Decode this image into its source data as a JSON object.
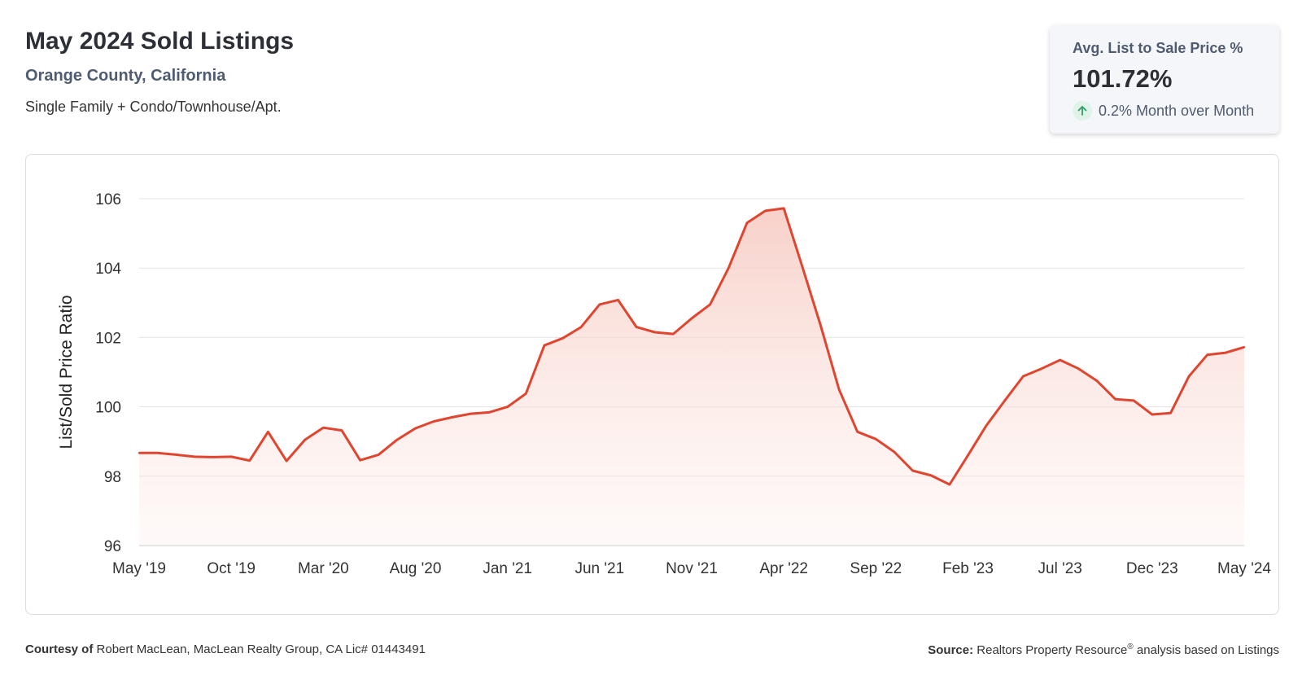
{
  "header": {
    "title": "May 2024 Sold Listings",
    "location": "Orange County, California",
    "segment": "Single Family + Condo/Townhouse/Apt."
  },
  "kpi": {
    "label": "Avg. List to Sale Price %",
    "value": "101.72%",
    "change": "0.2% Month over Month",
    "change_icon": "arrow-up-icon",
    "change_color": "#2e9e6a"
  },
  "footer": {
    "courtesy_label": "Courtesy of",
    "courtesy_text": "Robert MacLean, MacLean Realty Group, CA Lic# 01443491",
    "source_label": "Source:",
    "source_text_1": "Realtors Property Resource",
    "source_sup": "®",
    "source_text_2": "analysis based on Listings"
  },
  "colors": {
    "line": "#e0452f",
    "fill_top": "#f6c9c0",
    "grid": "#e3e3e3",
    "axis_text": "#333333"
  },
  "chart_data": {
    "type": "area",
    "title": "",
    "xlabel": "",
    "ylabel": "List/Sold Price Ratio",
    "ylim": [
      96,
      106
    ],
    "yticks": [
      96,
      98,
      100,
      102,
      104,
      106
    ],
    "grid": true,
    "x_tick_labels": [
      "May '19",
      "Oct '19",
      "Mar '20",
      "Aug '20",
      "Jan '21",
      "Jun '21",
      "Nov '21",
      "Apr '22",
      "Sep '22",
      "Feb '23",
      "Jul '23",
      "Dec '23",
      "May '24"
    ],
    "x": [
      "May '19",
      "Jun '19",
      "Jul '19",
      "Aug '19",
      "Sep '19",
      "Oct '19",
      "Nov '19",
      "Dec '19",
      "Jan '20",
      "Feb '20",
      "Mar '20",
      "Apr '20",
      "May '20",
      "Jun '20",
      "Jul '20",
      "Aug '20",
      "Sep '20",
      "Oct '20",
      "Nov '20",
      "Dec '20",
      "Jan '21",
      "Feb '21",
      "Mar '21",
      "Apr '21",
      "May '21",
      "Jun '21",
      "Jul '21",
      "Aug '21",
      "Sep '21",
      "Oct '21",
      "Nov '21",
      "Dec '21",
      "Jan '22",
      "Feb '22",
      "Mar '22",
      "Apr '22",
      "May '22",
      "Jun '22",
      "Jul '22",
      "Aug '22",
      "Sep '22",
      "Oct '22",
      "Nov '22",
      "Dec '22",
      "Jan '23",
      "Feb '23",
      "Mar '23",
      "Apr '23",
      "May '23",
      "Jun '23",
      "Jul '23",
      "Aug '23",
      "Sep '23",
      "Oct '23",
      "Nov '23",
      "Dec '23",
      "Jan '24",
      "Feb '24",
      "Mar '24",
      "Apr '24",
      "May '24"
    ],
    "series": [
      {
        "values": [
          98.67,
          98.67,
          98.62,
          98.56,
          98.55,
          98.56,
          98.45,
          99.28,
          98.44,
          99.05,
          99.4,
          99.32,
          98.46,
          98.62,
          99.05,
          99.38,
          99.58,
          99.7,
          99.8,
          99.84,
          100.0,
          100.38,
          101.77,
          101.98,
          102.3,
          102.95,
          103.08,
          102.3,
          102.15,
          102.1,
          102.55,
          102.95,
          104.0,
          105.3,
          105.65,
          105.72,
          104.05,
          102.35,
          100.5,
          99.28,
          99.07,
          98.7,
          98.16,
          98.02,
          97.76,
          98.6,
          99.46,
          100.18,
          100.88,
          101.1,
          101.35,
          101.1,
          100.75,
          100.22,
          100.18,
          99.78,
          99.82,
          100.88,
          101.5,
          101.56,
          101.72
        ]
      }
    ]
  }
}
